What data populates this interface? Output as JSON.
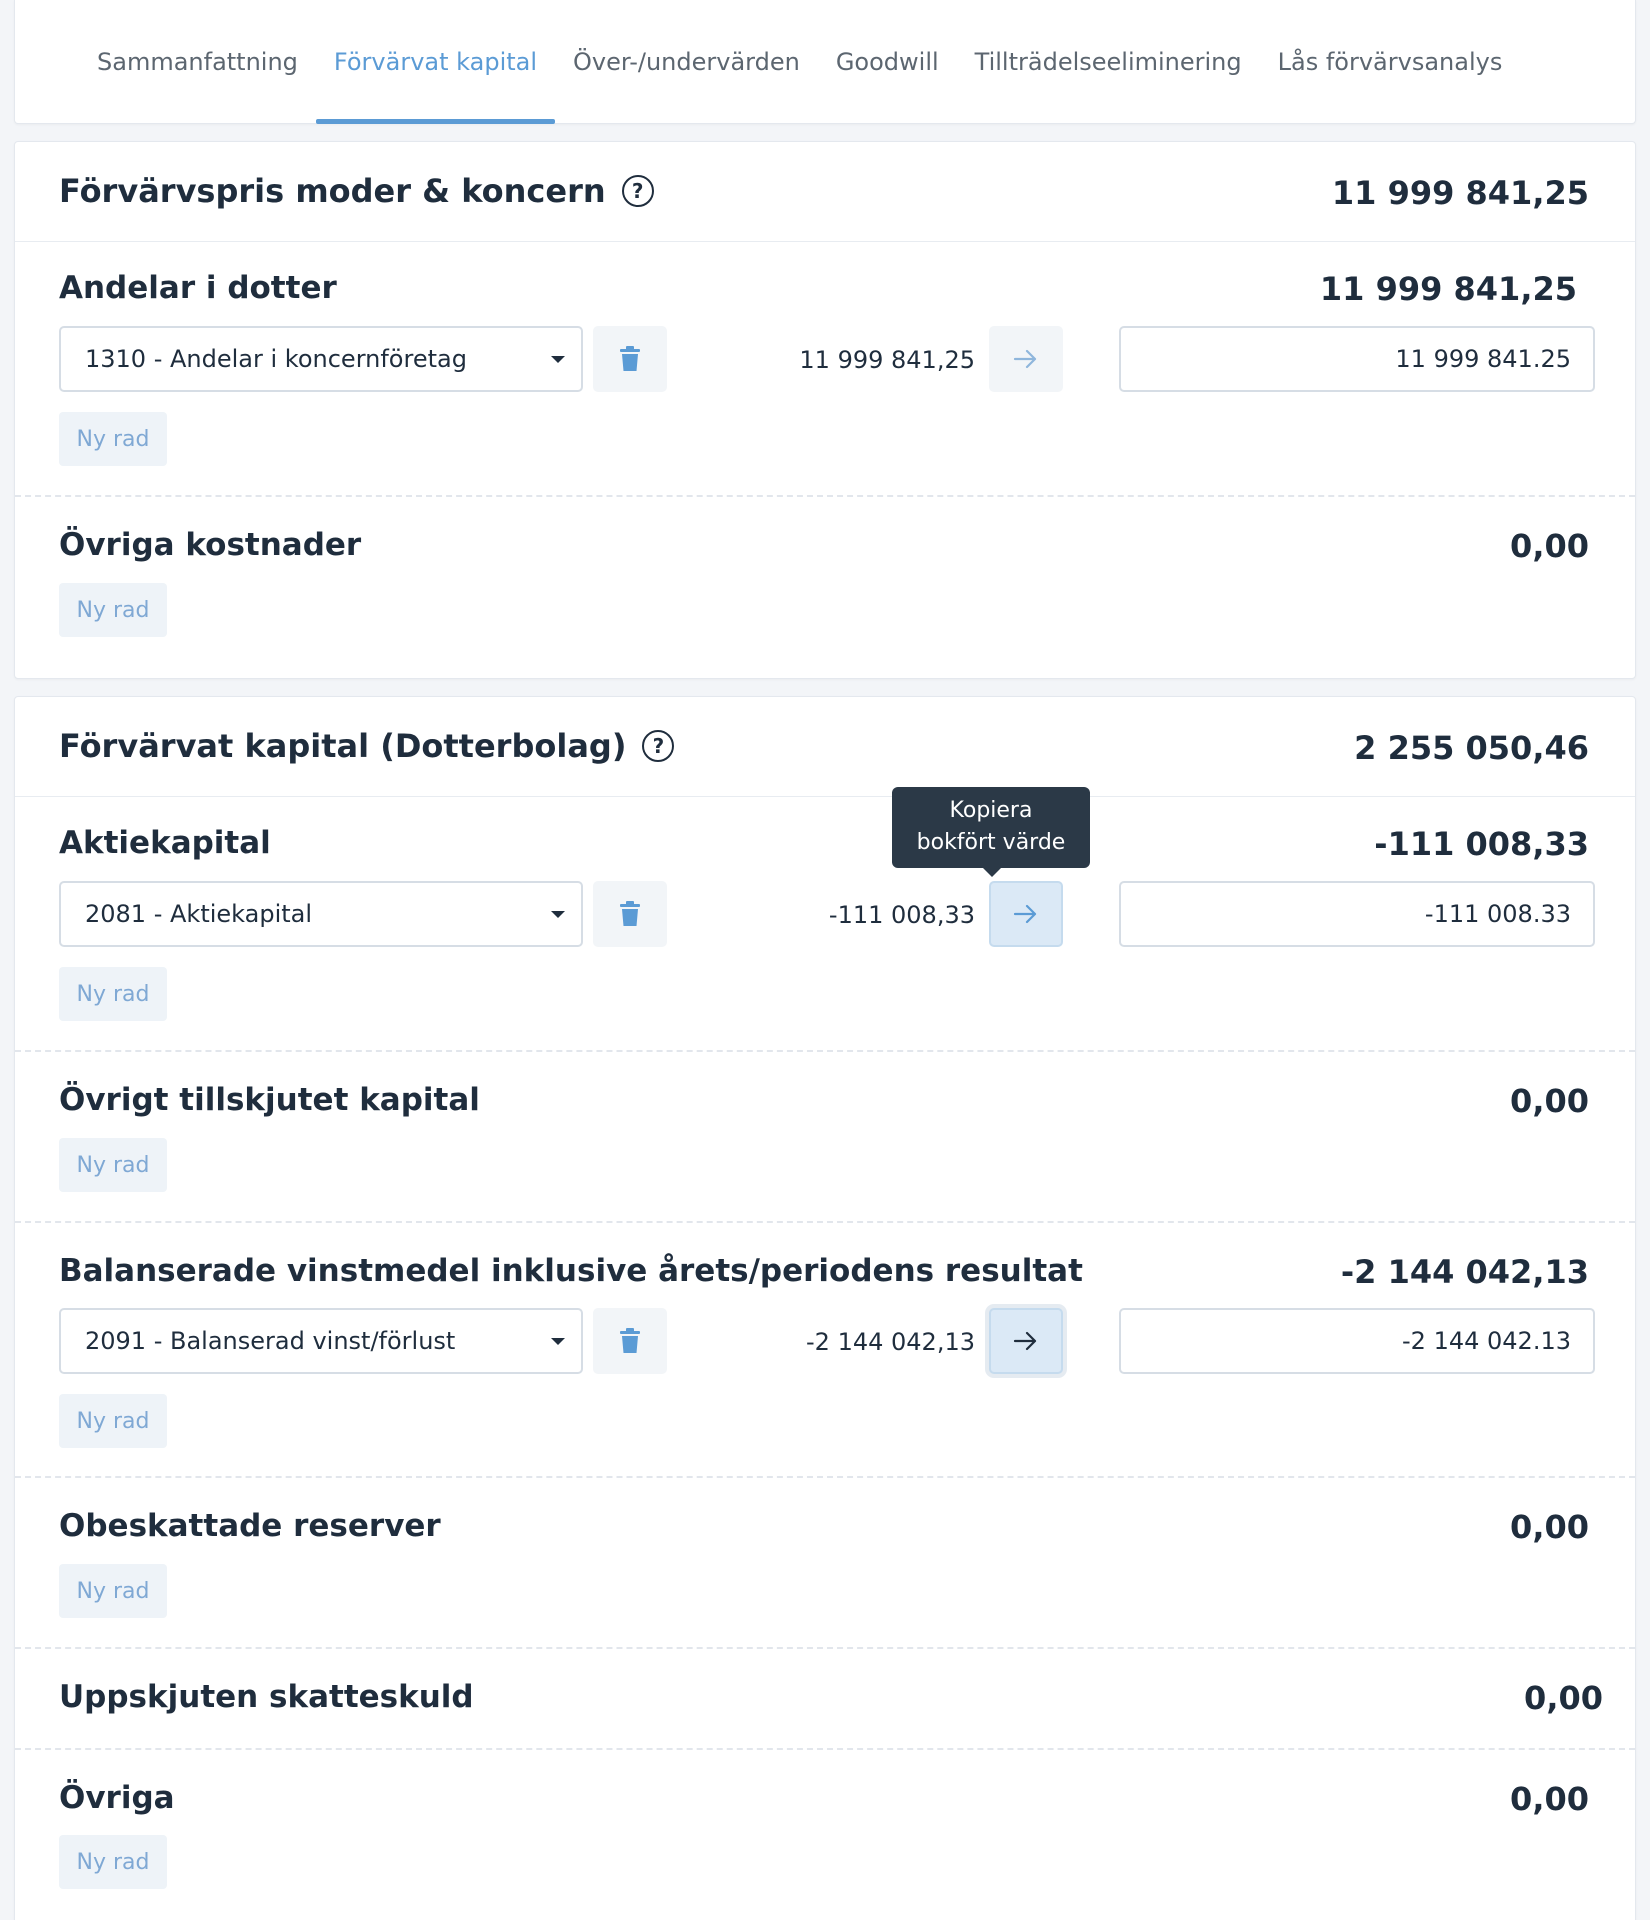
{
  "tabs": [
    {
      "label": "Sammanfattning"
    },
    {
      "label": "Förvärvat kapital"
    },
    {
      "label": "Över-/undervärden"
    },
    {
      "label": "Goodwill"
    },
    {
      "label": "Tillträdelseeliminering"
    },
    {
      "label": "Lås förvärvsanalys"
    }
  ],
  "purchase": {
    "title": "Förvärvspris moder & koncern",
    "total": "11 999 841,25",
    "shares": {
      "title": "Andelar i dotter",
      "amount": "11 999 841,25",
      "account": "1310 - Andelar i koncernföretag",
      "booked": "11 999 841,25",
      "value": "11 999 841.25"
    },
    "other_costs": {
      "title": "Övriga kostnader",
      "amount": "0,00"
    }
  },
  "acquired": {
    "title": "Förvärvat kapital (Dotterbolag)",
    "total": "2 255 050,46",
    "share_capital": {
      "title": "Aktiekapital",
      "amount": "-111 008,33",
      "account": "2081 - Aktiekapital",
      "booked": "-111 008,33",
      "value": "-111 008.33"
    },
    "other_contributed": {
      "title": "Övrigt tillskjutet kapital",
      "amount": "0,00"
    },
    "retained": {
      "title": "Balanserade vinstmedel inklusive årets/periodens resultat",
      "amount": "-2 144 042,13",
      "account": "2091 - Balanserad vinst/förlust",
      "booked": "-2 144 042,13",
      "value": "-2 144 042.13"
    },
    "untaxed": {
      "title": "Obeskattade reserver",
      "amount": "0,00"
    },
    "deferred_tax": {
      "title": "Uppskjuten skatteskuld",
      "amount": "0,00"
    },
    "other": {
      "title": "Övriga",
      "amount": "0,00"
    }
  },
  "common": {
    "new_row": "Ny rad",
    "tooltip_line1": "Kopiera",
    "tooltip_line2": "bokfört värde"
  },
  "colors": {
    "accent": "#5b9bd5",
    "text": "#1f2d3d",
    "tooltip_bg": "#2b3947"
  }
}
